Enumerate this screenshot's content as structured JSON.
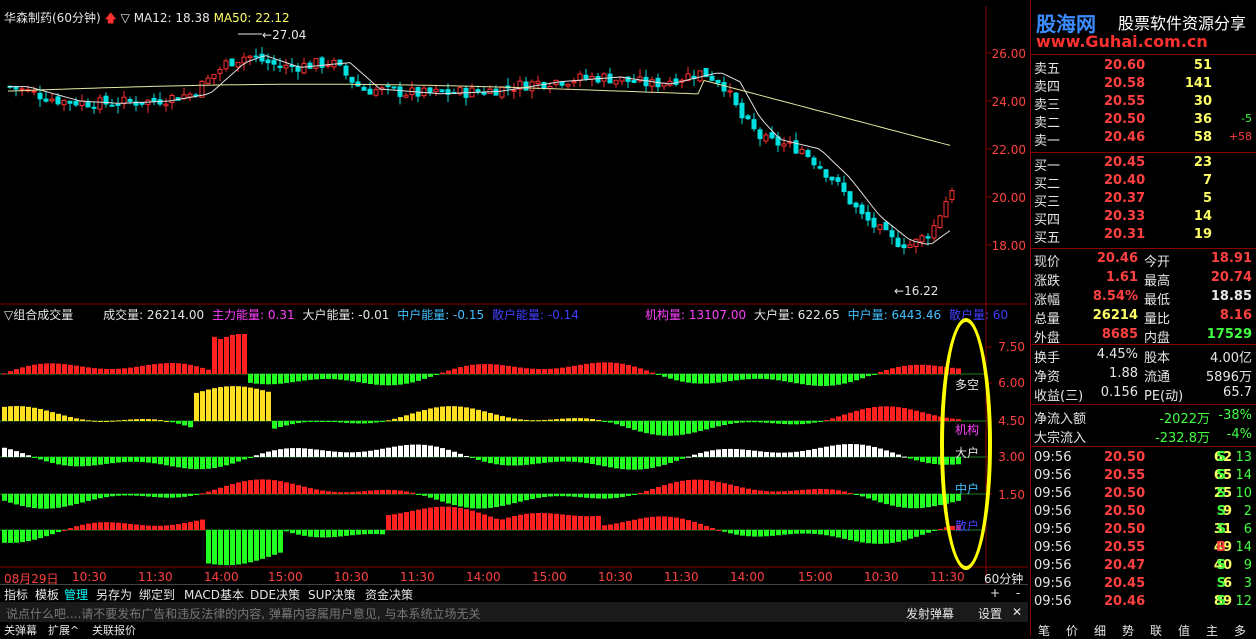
{
  "top_header": {
    "title": "华森制药(60分钟)",
    "ma12_label": "MA12: 18.38",
    "ma50_label": "MA50: 22.12",
    "marker_high": "27.04",
    "marker_low": "16.22"
  },
  "price_axis": [
    "26.00",
    "24.00",
    "22.00",
    "20.00",
    "18.00"
  ],
  "sub_axis": [
    "7.50",
    "6.00",
    "4.50",
    "3.00",
    "1.50"
  ],
  "sub_header": {
    "name": "组合成交量",
    "volume": "成交量: 26214.00",
    "zl": "主力能量: 0.31",
    "dh": "大户能量: -0.01",
    "zh": "中户能量: -0.15",
    "sh": "散户能量: -0.14",
    "jg_vol": "机构量: 13107.00",
    "dh_vol": "大户量: 622.65",
    "zh_vol": "中户量: 6443.46",
    "sh_vol": "散户量: 60"
  },
  "sub_labels": {
    "duokong": "多空",
    "jigou": "机构",
    "dahu": "大户",
    "zhonghu": "中户",
    "sanhu": "散户"
  },
  "time_axis": [
    "08月29日",
    "10:30",
    "11:30",
    "14:00",
    "15:00",
    "10:30",
    "11:30",
    "14:00",
    "15:00",
    "10:30",
    "11:30",
    "14:00",
    "15:00",
    "10:30",
    "11:30"
  ],
  "period_label": "60分钟",
  "tabs": [
    "指标",
    "模板",
    "管理",
    "另存为",
    "绑定到",
    "MACD基本",
    "DDE决策",
    "SUP决策",
    "资金决策"
  ],
  "tab_plus": "+",
  "tab_minus": "-",
  "message_placeholder": "说点什么吧....请不要发布广告和违反法律的内容, 弹幕内容属用户意见, 与本系统立场无关",
  "send_button": "发射弹幕",
  "settings_button": "设置",
  "close_icon": "✕",
  "bottom_left": [
    "关弹幕",
    "扩展^",
    "关联报价"
  ],
  "logo": {
    "brand": "股海网",
    "slogan": "股票软件资源分享",
    "url": "www.Guhai.com.cn"
  },
  "sell_orders": [
    {
      "label": "卖五",
      "price": "20.60",
      "vol": "51",
      "chg": ""
    },
    {
      "label": "卖四",
      "price": "20.58",
      "vol": "141",
      "chg": ""
    },
    {
      "label": "卖三",
      "price": "20.55",
      "vol": "30",
      "chg": ""
    },
    {
      "label": "卖二",
      "price": "20.50",
      "vol": "36",
      "chg": "-5"
    },
    {
      "label": "卖一",
      "price": "20.46",
      "vol": "58",
      "chg": "+58"
    }
  ],
  "buy_orders": [
    {
      "label": "买一",
      "price": "20.45",
      "vol": "23"
    },
    {
      "label": "买二",
      "price": "20.40",
      "vol": "7"
    },
    {
      "label": "买三",
      "price": "20.37",
      "vol": "5"
    },
    {
      "label": "买四",
      "price": "20.33",
      "vol": "14"
    },
    {
      "label": "买五",
      "price": "20.31",
      "vol": "19"
    }
  ],
  "quote_stats": [
    {
      "l1": "现价",
      "v1": "20.46",
      "l2": "今开",
      "v2": "18.91"
    },
    {
      "l1": "涨跌",
      "v1": "1.61",
      "l2": "最高",
      "v2": "20.74"
    },
    {
      "l1": "涨幅",
      "v1": "8.54%",
      "l2": "最低",
      "v2": "18.85"
    },
    {
      "l1": "总量",
      "v1": "26214",
      "l2": "量比",
      "v2": "8.16"
    },
    {
      "l1": "外盘",
      "v1": "8685",
      "l2": "内盘",
      "v2": "17529"
    }
  ],
  "fund_stats": [
    {
      "l1": "换手",
      "v1": "4.45%",
      "l2": "股本",
      "v2": "4.00亿"
    },
    {
      "l1": "净资",
      "v1": "1.88",
      "l2": "流通",
      "v2": "5896万"
    },
    {
      "l1": "收益(三)",
      "v1": "0.156",
      "l2": "PE(动)",
      "v2": "65.7"
    }
  ],
  "flow_stats": [
    {
      "label": "净流入额",
      "value": "-2022万",
      "pct": "-38%"
    },
    {
      "label": "大宗流入",
      "value": "-232.8万",
      "pct": "-4%"
    }
  ],
  "ticks": [
    {
      "time": "09:56",
      "price": "20.50",
      "vol": "62",
      "side": "S",
      "n": "13"
    },
    {
      "time": "09:56",
      "price": "20.55",
      "vol": "65",
      "side": "S",
      "n": "14"
    },
    {
      "time": "09:56",
      "price": "20.50",
      "vol": "25",
      "side": "S",
      "n": "10"
    },
    {
      "time": "09:56",
      "price": "20.50",
      "vol": "9",
      "side": "S",
      "n": "2"
    },
    {
      "time": "09:56",
      "price": "20.50",
      "vol": "31",
      "side": "S",
      "n": "6"
    },
    {
      "time": "09:56",
      "price": "20.55",
      "vol": "49",
      "side": "B",
      "n": "14"
    },
    {
      "time": "09:56",
      "price": "20.47",
      "vol": "40",
      "side": "S",
      "n": "9"
    },
    {
      "time": "09:56",
      "price": "20.45",
      "vol": "6",
      "side": "S",
      "n": "3"
    },
    {
      "time": "09:56",
      "price": "20.46",
      "vol": "89",
      "side": "S",
      "n": "12"
    }
  ],
  "bottom_right_tabs": [
    "笔",
    "价",
    "细",
    "势",
    "联",
    "值",
    "主",
    "多"
  ]
}
